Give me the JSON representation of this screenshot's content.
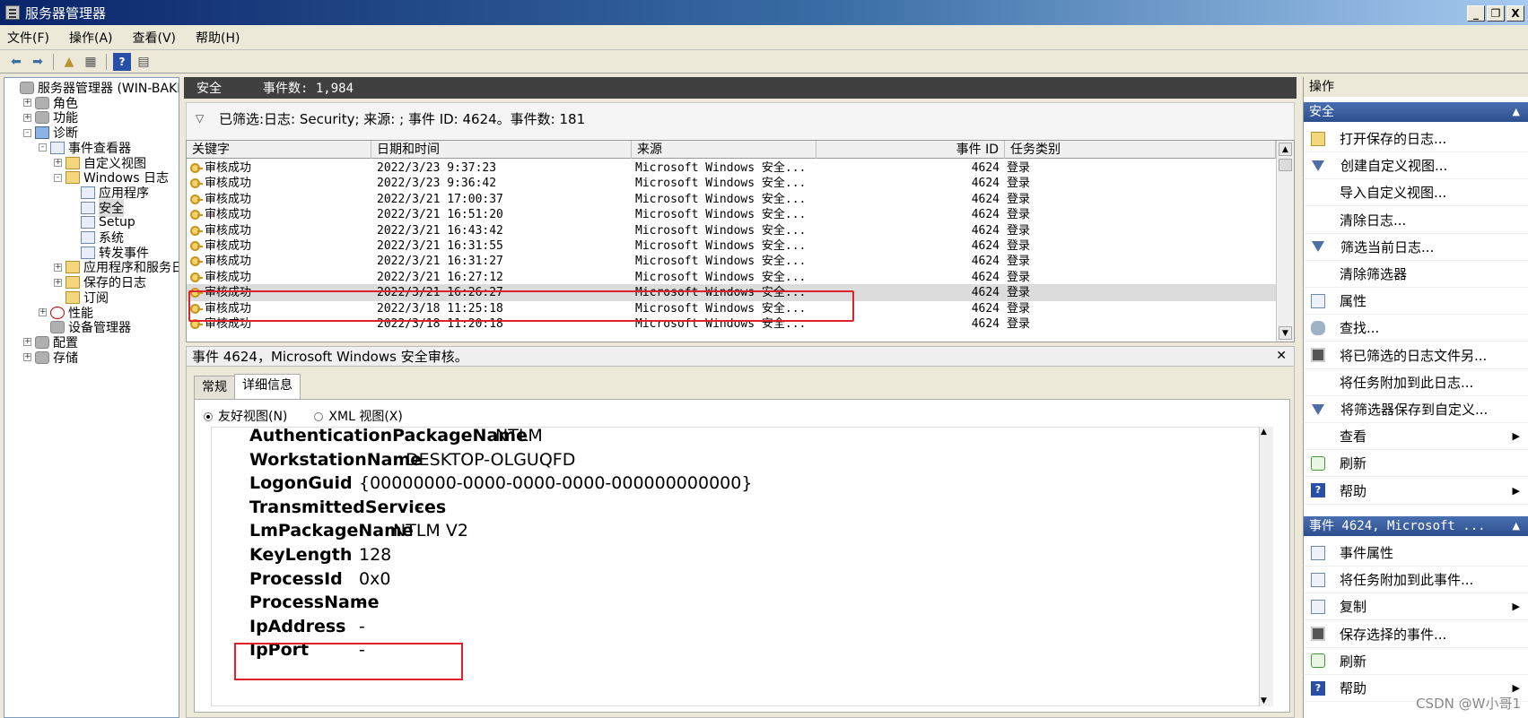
{
  "window": {
    "title": "服务器管理器",
    "buttons": [
      "_",
      "❐",
      "X"
    ]
  },
  "menu": [
    "文件(F)",
    "操作(A)",
    "查看(V)",
    "帮助(H)"
  ],
  "toolbar_icons": [
    "back-icon",
    "forward-icon",
    "up-icon",
    "show-tree-icon",
    "help-icon",
    "properties-icon"
  ],
  "tree": {
    "nodes": [
      {
        "label": "服务器管理器 (WIN-BAKD",
        "level": 0,
        "expander": ""
      },
      {
        "label": "角色",
        "level": 1,
        "expander": "+"
      },
      {
        "label": "功能",
        "level": 1,
        "expander": "+"
      },
      {
        "label": "诊断",
        "level": 1,
        "expander": "-"
      },
      {
        "label": "事件查看器",
        "level": 2,
        "expander": "-"
      },
      {
        "label": "自定义视图",
        "level": 3,
        "expander": "+"
      },
      {
        "label": "Windows 日志",
        "level": 3,
        "expander": "-"
      },
      {
        "label": "应用程序",
        "level": 4,
        "expander": ""
      },
      {
        "label": "安全",
        "level": 4,
        "expander": ""
      },
      {
        "label": "Setup",
        "level": 4,
        "expander": ""
      },
      {
        "label": "系统",
        "level": 4,
        "expander": ""
      },
      {
        "label": "转发事件",
        "level": 4,
        "expander": ""
      },
      {
        "label": "应用程序和服务日",
        "level": 3,
        "expander": "+"
      },
      {
        "label": "保存的日志",
        "level": 3,
        "expander": "+"
      },
      {
        "label": "订阅",
        "level": 3,
        "expander": ""
      },
      {
        "label": "性能",
        "level": 2,
        "expander": "+"
      },
      {
        "label": "设备管理器",
        "level": 2,
        "expander": ""
      },
      {
        "label": "配置",
        "level": 1,
        "expander": "+"
      },
      {
        "label": "存储",
        "level": 1,
        "expander": "+"
      }
    ]
  },
  "center": {
    "header_title": "安全",
    "header_count": "事件数: 1,984",
    "filter_text": "已筛选:日志: Security; 来源: ; 事件 ID: 4624。事件数: 181",
    "columns": [
      "关键字",
      "日期和时间",
      "来源",
      "事件 ID",
      "任务类别"
    ],
    "rows": [
      {
        "keyword": "审核成功",
        "datetime": "2022/3/23 9:37:23",
        "source": "Microsoft Windows 安全...",
        "event_id": "4624",
        "category": "登录"
      },
      {
        "keyword": "审核成功",
        "datetime": "2022/3/23 9:36:42",
        "source": "Microsoft Windows 安全...",
        "event_id": "4624",
        "category": "登录"
      },
      {
        "keyword": "审核成功",
        "datetime": "2022/3/21 17:00:37",
        "source": "Microsoft Windows 安全...",
        "event_id": "4624",
        "category": "登录"
      },
      {
        "keyword": "审核成功",
        "datetime": "2022/3/21 16:51:20",
        "source": "Microsoft Windows 安全...",
        "event_id": "4624",
        "category": "登录"
      },
      {
        "keyword": "审核成功",
        "datetime": "2022/3/21 16:43:42",
        "source": "Microsoft Windows 安全...",
        "event_id": "4624",
        "category": "登录"
      },
      {
        "keyword": "审核成功",
        "datetime": "2022/3/21 16:31:55",
        "source": "Microsoft Windows 安全...",
        "event_id": "4624",
        "category": "登录"
      },
      {
        "keyword": "审核成功",
        "datetime": "2022/3/21 16:31:27",
        "source": "Microsoft Windows 安全...",
        "event_id": "4624",
        "category": "登录"
      },
      {
        "keyword": "审核成功",
        "datetime": "2022/3/21 16:27:12",
        "source": "Microsoft Windows 安全...",
        "event_id": "4624",
        "category": "登录"
      },
      {
        "keyword": "审核成功",
        "datetime": "2022/3/21 16:26:27",
        "source": "Microsoft Windows 安全...",
        "event_id": "4624",
        "category": "登录",
        "selected": true
      },
      {
        "keyword": "审核成功",
        "datetime": "2022/3/18 11:25:18",
        "source": "Microsoft Windows 安全...",
        "event_id": "4624",
        "category": "登录"
      },
      {
        "keyword": "审核成功",
        "datetime": "2022/3/18 11:20:18",
        "source": "Microsoft Windows 安全...",
        "event_id": "4624",
        "category": "登录"
      }
    ]
  },
  "detail": {
    "title": "事件 4624，Microsoft Windows 安全审核。",
    "tabs": [
      "常规",
      "详细信息"
    ],
    "active_tab": "详细信息",
    "view_options": [
      "友好视图(N)",
      "XML 视图(X)"
    ],
    "fields": [
      {
        "key": "AuthenticationPackageName",
        "value": "NTLM"
      },
      {
        "key": "WorkstationName",
        "value": "DESKTOP-OLGUQFD"
      },
      {
        "key": "LogonGuid",
        "value": "{00000000-0000-0000-0000-000000000000}"
      },
      {
        "key": "TransmittedServices",
        "value": "-"
      },
      {
        "key": "LmPackageName",
        "value": "NTLM V2"
      },
      {
        "key": "KeyLength",
        "value": "128"
      },
      {
        "key": "ProcessId",
        "value": "0x0"
      },
      {
        "key": "ProcessName",
        "value": "-"
      },
      {
        "key": "IpAddress",
        "value": "-"
      },
      {
        "key": "IpPort",
        "value": "-"
      }
    ]
  },
  "actions": {
    "title": "操作",
    "section1": "安全",
    "items1": [
      {
        "label": "打开保存的日志...",
        "icon": "folder",
        "sub": false
      },
      {
        "label": "创建自定义视图...",
        "icon": "funnel",
        "sub": false
      },
      {
        "label": "导入自定义视图...",
        "icon": "none",
        "sub": false
      },
      {
        "label": "清除日志...",
        "icon": "none",
        "sub": false
      },
      {
        "label": "筛选当前日志...",
        "icon": "funnel",
        "sub": false
      },
      {
        "label": "清除筛选器",
        "icon": "none",
        "sub": false
      },
      {
        "label": "属性",
        "icon": "doc",
        "sub": false
      },
      {
        "label": "查找...",
        "icon": "bin",
        "sub": false
      },
      {
        "label": "将已筛选的日志文件另...",
        "icon": "disk",
        "sub": false
      },
      {
        "label": "将任务附加到此日志...",
        "icon": "none",
        "sub": false
      },
      {
        "label": "将筛选器保存到自定义...",
        "icon": "funnel",
        "sub": false
      },
      {
        "label": "查看",
        "icon": "none",
        "sub": true
      },
      {
        "label": "刷新",
        "icon": "refresh",
        "sub": false
      },
      {
        "label": "帮助",
        "icon": "help",
        "sub": true
      }
    ],
    "section2": "事件 4624, Microsoft ...",
    "items2": [
      {
        "label": "事件属性",
        "icon": "doc",
        "sub": false
      },
      {
        "label": "将任务附加到此事件...",
        "icon": "doc",
        "sub": false
      },
      {
        "label": "复制",
        "icon": "doc",
        "sub": true
      },
      {
        "label": "保存选择的事件...",
        "icon": "disk",
        "sub": false
      },
      {
        "label": "刷新",
        "icon": "refresh",
        "sub": false
      },
      {
        "label": "帮助",
        "icon": "help",
        "sub": true
      }
    ]
  },
  "watermark": "CSDN @W小哥1"
}
